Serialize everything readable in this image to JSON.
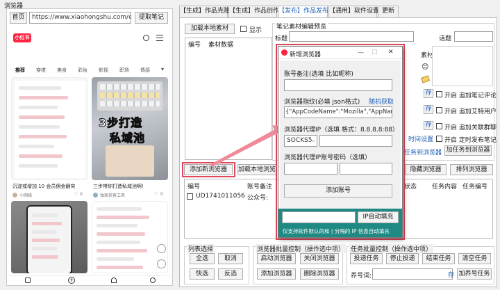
{
  "window": {
    "title": "浏览器"
  },
  "browser": {
    "home_label": "首页",
    "url": "https://www.xiaohongshu.com/explor",
    "extract_label": "提取笔记",
    "logo_text": "小红书",
    "categories": [
      "推荐",
      "穿搭",
      "美食",
      "彩妆",
      "影视",
      "职场",
      "情感"
    ],
    "card_big_text_line1": "3步打造",
    "card_big_text_line2": "私域池",
    "card1_caption": "沉淀或增加 10 会员佣金翻突",
    "card1_user": "小网络",
    "card2_caption": "三步带你打造私域池啊!",
    "card2_user": "独家获客工具",
    "card1_likes": "0",
    "card2_likes": "0"
  },
  "tabs": [
    {
      "label": "【生成】作品克隆"
    },
    {
      "label": "【生成】作品创作"
    },
    {
      "label": "【发布】作品发布"
    },
    {
      "label": "【通用】软件设置"
    },
    {
      "label": "更新"
    }
  ],
  "main": {
    "load_local_label": "加载本地素材",
    "show_label": "显示",
    "preview_group_label": "笔记素材编辑预览",
    "title_label": "标题",
    "topic_label": "话题",
    "material_label": "素材",
    "table_headers": [
      "编号",
      "素材数据"
    ],
    "add_browser_label": "添加新浏览器",
    "load_local_browser_label": "加载本地浏览",
    "hide_browser_label": "隐藏浏览器",
    "arrange_browser_label": "排列浏览器",
    "time_setting_label": "时间设置",
    "add_task_label": "加任务到浏览器",
    "save_label": "存",
    "options": [
      {
        "label": "开启 追加笔记评论"
      },
      {
        "label": "开启 追加艾特用户"
      },
      {
        "label": "开启 追加关联群聊"
      },
      {
        "label": "开启 定时发布笔记"
      }
    ],
    "browser_table_headers": [
      "编号",
      "账号备注",
      "状态",
      "任务内容",
      "任务编号"
    ],
    "browser_row_id": "UD1741011056",
    "browser_row_note": "公众号:",
    "list_select_label": "列表选择",
    "select_all": "全选",
    "cancel": "取消",
    "quick_select": "快选",
    "invert_select": "反选",
    "batch_browser_label": "浏览器批量控制（操作选中项）",
    "start_browser": "启动浏览器",
    "close_browser": "关闭浏览器",
    "add_browser": "添加浏览器",
    "delete_browser": "删除浏览器",
    "batch_task_label": "任务批量控制（操作选中项）",
    "dispatch_task": "投递任务",
    "stop_dispatch": "停止投递",
    "end_task": "结束任务",
    "clear_task": "清空任务",
    "task_word_label": "养号词:",
    "add_nurture_task": "加养号任务"
  },
  "dialog": {
    "title": "新增浏览器",
    "minimize": "—",
    "maximize": "□",
    "close": "✕",
    "note_label": "账号备注(选填 比如昵称)",
    "fingerprint_label": "浏览器指纹(必填 json格式)",
    "random_label": "随机获取",
    "fingerprint_value": "{\"AppCodeName\":\"Mozilla\",\"AppName\"",
    "proxy_label": "浏览器代理IP（选填 格式：8.8.8.8:88）",
    "proxy_type": "SOCKS5",
    "proxy_auth_label": "浏览器代理IP账号密码（选填）",
    "add_account_label": "添加账号",
    "ip_fill_label": "IP自动填充",
    "footer_text": "仅支持软件默认的和 | 分隔的 IP 信息自动填充"
  },
  "colors": {
    "accent": "#1e5fb8",
    "highlight": "#e0475a",
    "dialog_footer": "#1f8a84",
    "xhs_red": "#ff2442"
  }
}
